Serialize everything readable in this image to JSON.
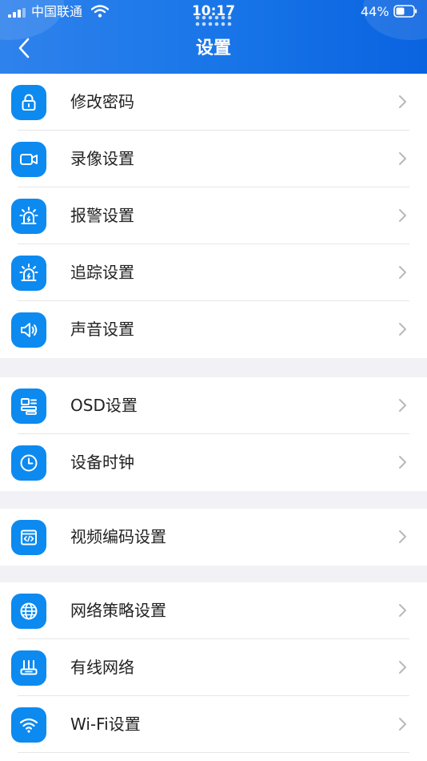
{
  "status_bar": {
    "carrier": "中国联通",
    "time": "10:17",
    "battery": "44%"
  },
  "header": {
    "title": "设置"
  },
  "colors": {
    "header_blue": "#1976e8",
    "icon_blue": "#0c8af0",
    "separator_band": "#f2f2f6"
  },
  "groups": [
    {
      "items": [
        {
          "label": "修改密码",
          "icon": "lock-icon"
        },
        {
          "label": "录像设置",
          "icon": "video-camera-icon"
        },
        {
          "label": "报警设置",
          "icon": "alarm-icon"
        },
        {
          "label": "追踪设置",
          "icon": "alarm-icon"
        },
        {
          "label": "声音设置",
          "icon": "speaker-icon"
        }
      ]
    },
    {
      "items": [
        {
          "label": "OSD设置",
          "icon": "osd-layout-icon"
        },
        {
          "label": "设备时钟",
          "icon": "clock-icon"
        }
      ]
    },
    {
      "items": [
        {
          "label": "视频编码设置",
          "icon": "code-window-icon"
        }
      ]
    },
    {
      "items": [
        {
          "label": "网络策略设置",
          "icon": "globe-icon"
        },
        {
          "label": "有线网络",
          "icon": "router-icon"
        },
        {
          "label": "Wi-Fi设置",
          "icon": "wifi-icon"
        }
      ]
    }
  ]
}
